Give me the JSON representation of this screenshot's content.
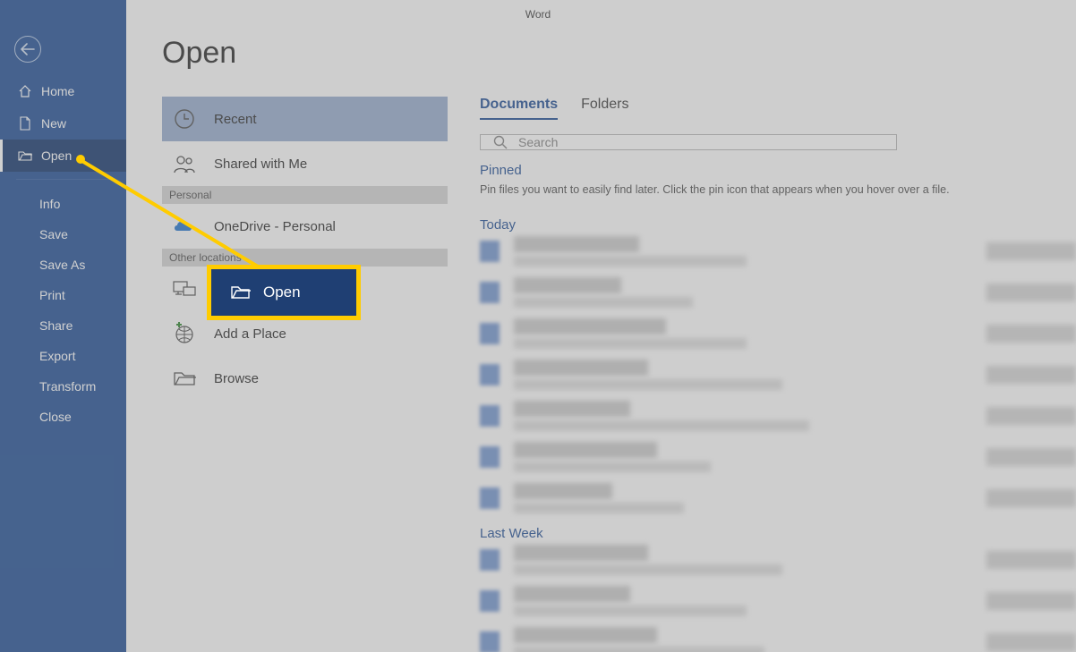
{
  "app_title": "Word",
  "page_heading": "Open",
  "sidebar": {
    "home": "Home",
    "new": "New",
    "open": "Open",
    "info": "Info",
    "save": "Save",
    "save_as": "Save As",
    "print": "Print",
    "share": "Share",
    "export": "Export",
    "transform": "Transform",
    "close": "Close"
  },
  "locations": {
    "recent": "Recent",
    "shared": "Shared with Me",
    "personal_header": "Personal",
    "onedrive": "OneDrive - Personal",
    "other_header": "Other locations",
    "this_pc": "This PC",
    "add_place": "Add a Place",
    "browse": "Browse"
  },
  "content": {
    "tab_documents": "Documents",
    "tab_folders": "Folders",
    "search_placeholder": "Search",
    "pinned_label": "Pinned",
    "pinned_hint": "Pin files you want to easily find later. Click the pin icon that appears when you hover over a file.",
    "today_label": "Today",
    "lastweek_label": "Last Week"
  },
  "callout": {
    "label": "Open"
  }
}
